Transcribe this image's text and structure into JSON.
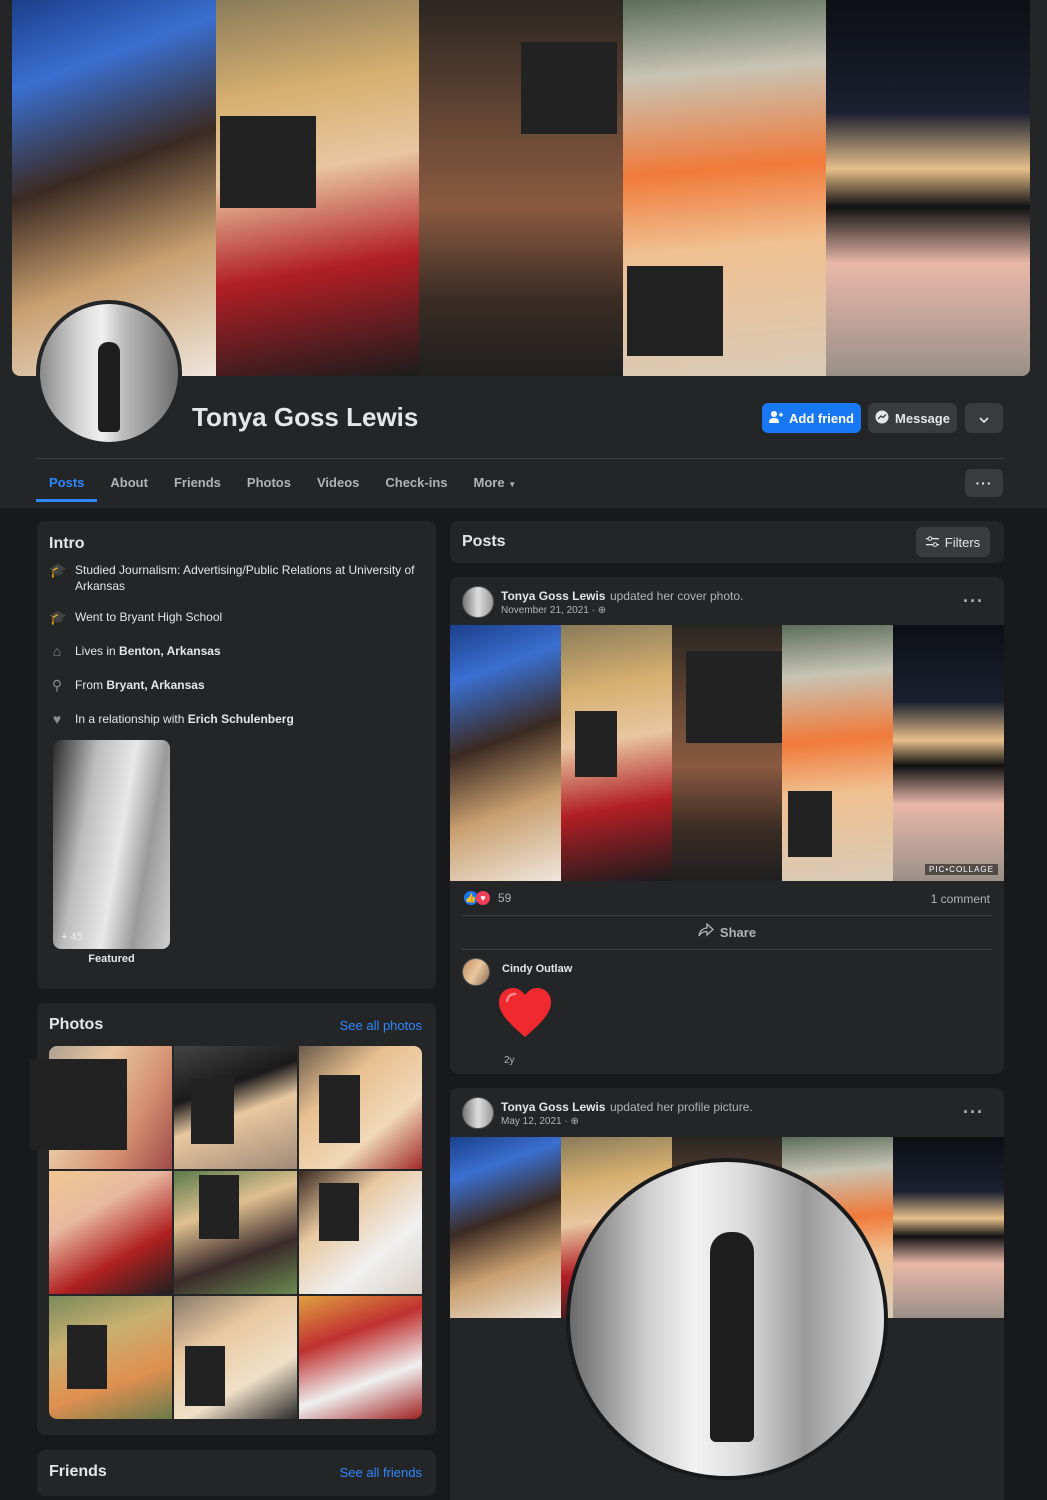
{
  "profile": {
    "name": "Tonya Goss Lewis",
    "add_friend": "Add friend",
    "message": "Message"
  },
  "tabs": [
    "Posts",
    "About",
    "Friends",
    "Photos",
    "Videos",
    "Check-ins",
    "More"
  ],
  "intro": {
    "title": "Intro",
    "studied": "Studied Journalism: Advertising/Public Relations at University of Arkansas",
    "went_to": "Went to Bryant High School",
    "lives_prefix": "Lives in",
    "lives_place": "Benton, Arkansas",
    "from_prefix": "From",
    "from_place": "Bryant, Arkansas",
    "relationship_prefix": "In a relationship with",
    "relationship_name": "Erich Schulenberg",
    "featured_count": "+ 45",
    "featured_label": "Featured"
  },
  "photos": {
    "title": "Photos",
    "see_all": "See all photos"
  },
  "friends": {
    "title": "Friends",
    "see_all": "See all friends"
  },
  "posts_header": {
    "title": "Posts",
    "filters": "Filters"
  },
  "post1": {
    "author": "Tonya Goss Lewis",
    "action": "updated her cover photo.",
    "date": "November 21, 2021 ·",
    "reactions_count": "59",
    "comments": "1 comment",
    "share": "Share",
    "watermark": "PIC•COLLAGE",
    "comment_author": "Cindy Outlaw",
    "comment_time": "2y"
  },
  "post2": {
    "author": "Tonya Goss Lewis",
    "action": "updated her profile picture.",
    "date": "May 12, 2021 ·"
  },
  "colors": {
    "accent": "#2d88ff",
    "button_primary": "#1877f2",
    "card": "#242526",
    "background": "#18191a"
  },
  "icons": [
    "add-person-icon",
    "messenger-icon",
    "chevron-down-icon",
    "more-dots-icon",
    "filter-icon",
    "graduation-cap-icon",
    "home-icon",
    "location-pin-icon",
    "heart-icon",
    "globe-icon",
    "like-icon",
    "love-icon",
    "share-icon"
  ]
}
